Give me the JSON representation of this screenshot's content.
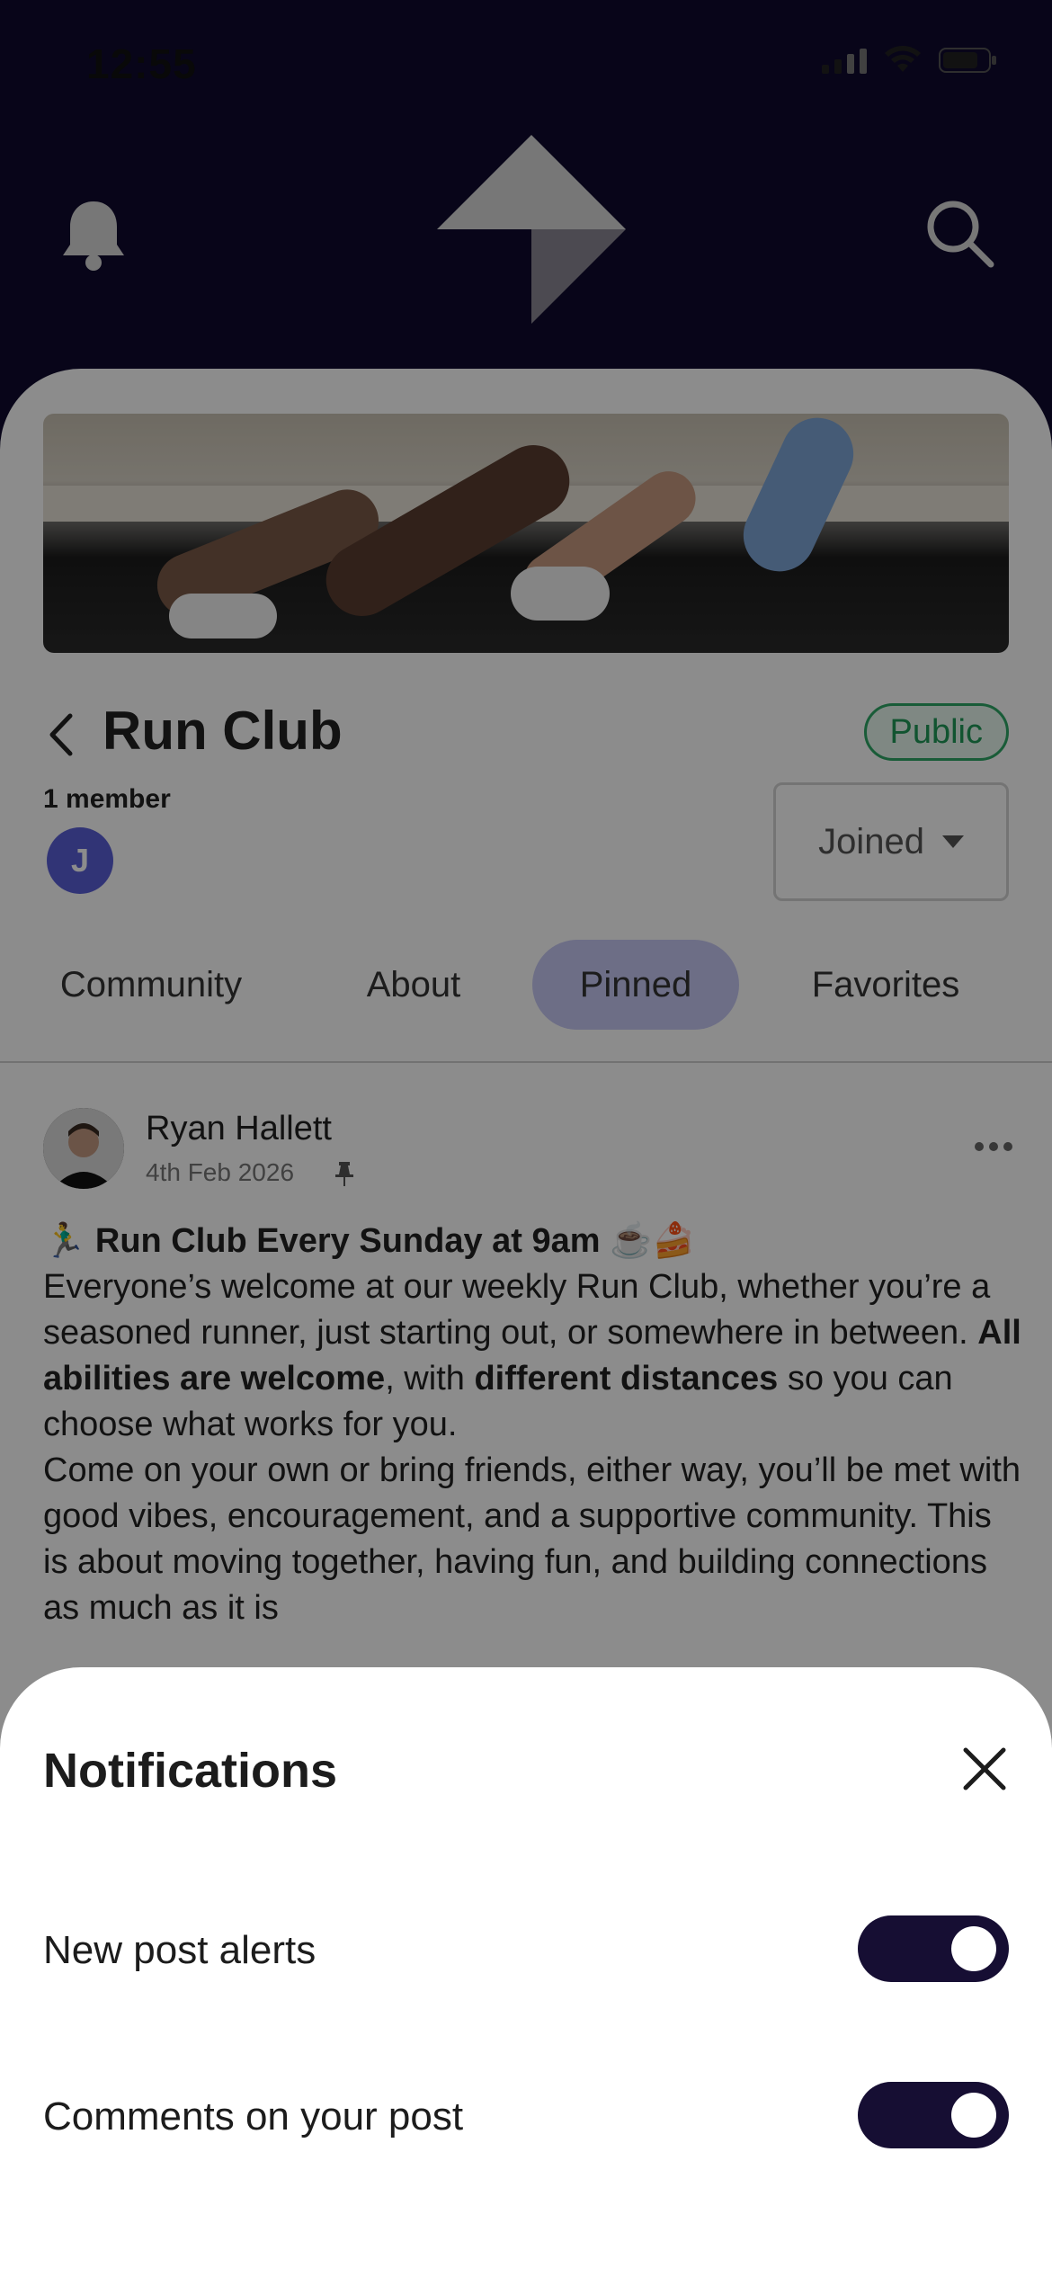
{
  "status_bar": {
    "time": "12:55"
  },
  "group": {
    "title": "Run Club",
    "visibility_badge": "Public",
    "member_count": "1 member",
    "member_avatar_initial": "J",
    "joined_label": "Joined"
  },
  "tabs": [
    {
      "label": "Community",
      "active": false
    },
    {
      "label": "About",
      "active": false
    },
    {
      "label": "Pinned",
      "active": true
    },
    {
      "label": "Favorites",
      "active": false
    }
  ],
  "post": {
    "author": "Ryan Hallett",
    "date": "4th Feb 2026",
    "heading": "🏃‍♂️ Run Club Every Sunday at 9am ☕🍰",
    "para1_a": "Everyone’s welcome at our weekly Run Club, whether you’re a seasoned runner, just starting out, or somewhere in between. ",
    "para1_b": "All abilities are welcome",
    "para1_c": ", with ",
    "para1_d": "different distances",
    "para1_e": " so you can choose what works for you.",
    "para2": "Come on your own or bring friends, either way, you’ll be met with good vibes, encouragement, and a supportive community. This is about moving together, having fun, and building connections as much as it is"
  },
  "sheet": {
    "title": "Notifications",
    "settings": [
      {
        "label": "New post alerts",
        "enabled": true
      },
      {
        "label": "Comments on your post",
        "enabled": true
      }
    ]
  },
  "colors": {
    "header_bg": "#0f0a2e",
    "toggle_on": "#160e33",
    "public_badge": "#1f9a58",
    "active_tab": "#c7c9f5",
    "avatar_j": "#5a5fd8"
  }
}
